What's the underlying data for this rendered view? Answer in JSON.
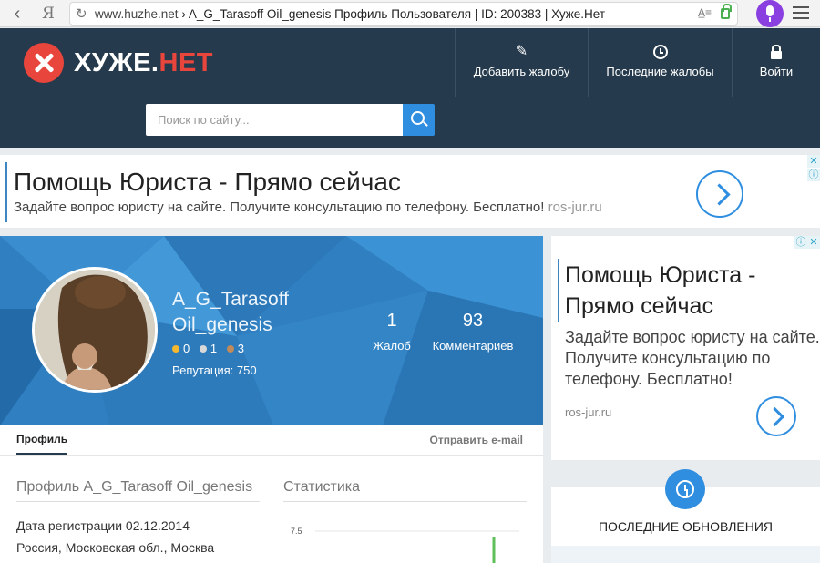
{
  "browser": {
    "url_host": "www.huzhe.net",
    "url_rest": "A_G_Tarasoff Oil_genesis Профиль Пользователя | ID: 200383 | Хуже.Нет",
    "back_icon": "chevron-left-icon",
    "ya_label": "Я"
  },
  "site": {
    "logo_main": "ХУЖЕ.",
    "logo_accent": "НЕТ",
    "nav": [
      {
        "label": "Добавить жалобу",
        "icon": "pen-icon"
      },
      {
        "label": "Последние жалобы",
        "icon": "clock-icon"
      },
      {
        "label": "Войти",
        "icon": "lock-icon"
      }
    ],
    "search_placeholder": "Поиск по сайту..."
  },
  "ad_top": {
    "title": "Помощь Юриста - Прямо сейчас",
    "desc": "Задайте вопрос юристу на сайте. Получите консультацию по телефону. Бесплатно!",
    "domain": "ros-jur.ru"
  },
  "profile": {
    "name_line1": "A_G_Tarasoff",
    "name_line2": "Oil_genesis",
    "medals": [
      {
        "count": "0",
        "color": "#f5b82e"
      },
      {
        "count": "1",
        "color": "#d9d9d9"
      },
      {
        "count": "3",
        "color": "#c08a5a"
      }
    ],
    "reputation": "Репутация: 750",
    "stats": [
      {
        "value": "1",
        "label": "Жалоб"
      },
      {
        "value": "93",
        "label": "Комментариев"
      }
    ],
    "tabs": {
      "profile": "Профиль",
      "email": "Отправить e-mail"
    },
    "section_profile_title": "Профиль A_G_Tarasoff Oil_genesis",
    "section_stats_title": "Статистика",
    "registration": "Дата регистрации 02.12.2014",
    "location": "Россия, Московская обл., Москва"
  },
  "chart_data": {
    "type": "line",
    "y_tick_labels": [
      "7.5"
    ],
    "series": []
  },
  "side_ad": {
    "title": "Помощь Юриста - Прямо сейчас",
    "desc": "Задайте вопрос юристу на сайте. Получите консультацию по телефону. Бесплатно!",
    "domain": "ros-jur.ru"
  },
  "updates": {
    "title": "ПОСЛЕДНИЕ ОБНОВЛЕНИЯ"
  },
  "colors": {
    "header_bg": "#253a4c",
    "accent_blue": "#2f8ee0",
    "logo_red": "#e8453c",
    "banner_blue": "#2f7fc1"
  }
}
